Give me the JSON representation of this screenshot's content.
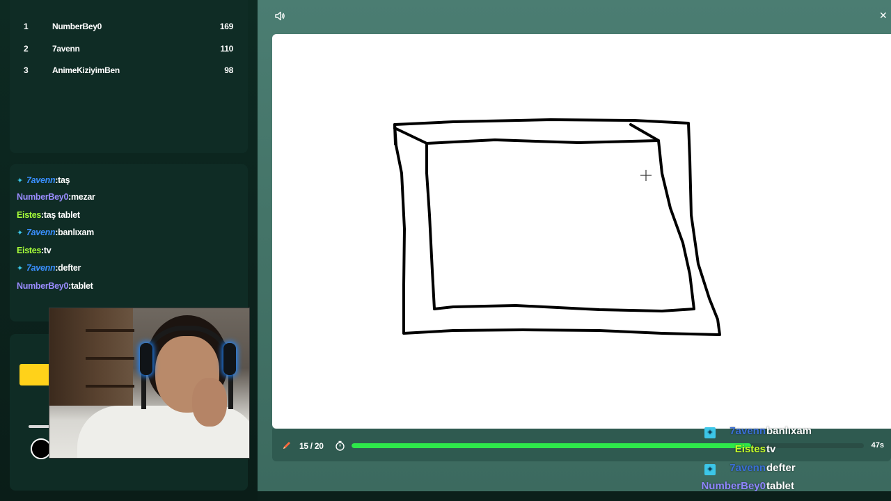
{
  "leaderboard": [
    {
      "rank": "1",
      "name": "NumberBey0",
      "score": "169"
    },
    {
      "rank": "2",
      "name": "7avenn",
      "score": "110"
    },
    {
      "rank": "3",
      "name": "AnimeKiziyimBen",
      "score": "98"
    }
  ],
  "chat": [
    {
      "user": "7avenn",
      "msg": ":taş",
      "badge": true
    },
    {
      "user": "NumberBey0",
      "msg": ":mezar",
      "badge": false
    },
    {
      "user": "Eistes",
      "msg": ":taş tablet",
      "badge": false
    },
    {
      "user": "7avenn",
      "msg": ":banlıxam",
      "badge": true
    },
    {
      "user": "Eistes",
      "msg": ":tv",
      "badge": false
    },
    {
      "user": "7avenn",
      "msg": ":defter",
      "badge": true
    },
    {
      "user": "NumberBey0",
      "msg": ":tablet",
      "badge": false
    }
  ],
  "game": {
    "round": "15 / 20",
    "time_left": "47s",
    "progress_fraction": 0.78
  },
  "overlay_chat": [
    {
      "user": "7avenn",
      "msg": "banlıxam",
      "badge": true
    },
    {
      "user": "Eistes",
      "msg": "tv",
      "badge": false
    },
    {
      "user": "7avenn",
      "msg": "defter",
      "badge": true
    },
    {
      "user": "NumberBey0",
      "msg": "tablet",
      "badge": false
    }
  ],
  "colors": {
    "progress": "#2ee84a",
    "user_7avenn": "#3a8fff",
    "user_numberbey0": "#9a8cff",
    "user_eistes": "#a8ff3a",
    "accent_yellow": "#ffd21a"
  },
  "icons": {
    "speaker": "speaker-icon",
    "close": "close-icon",
    "pencil": "pencil-icon",
    "timer": "timer-icon",
    "sword": "sword-badge-icon",
    "crosshair": "crosshair-cursor-icon"
  }
}
